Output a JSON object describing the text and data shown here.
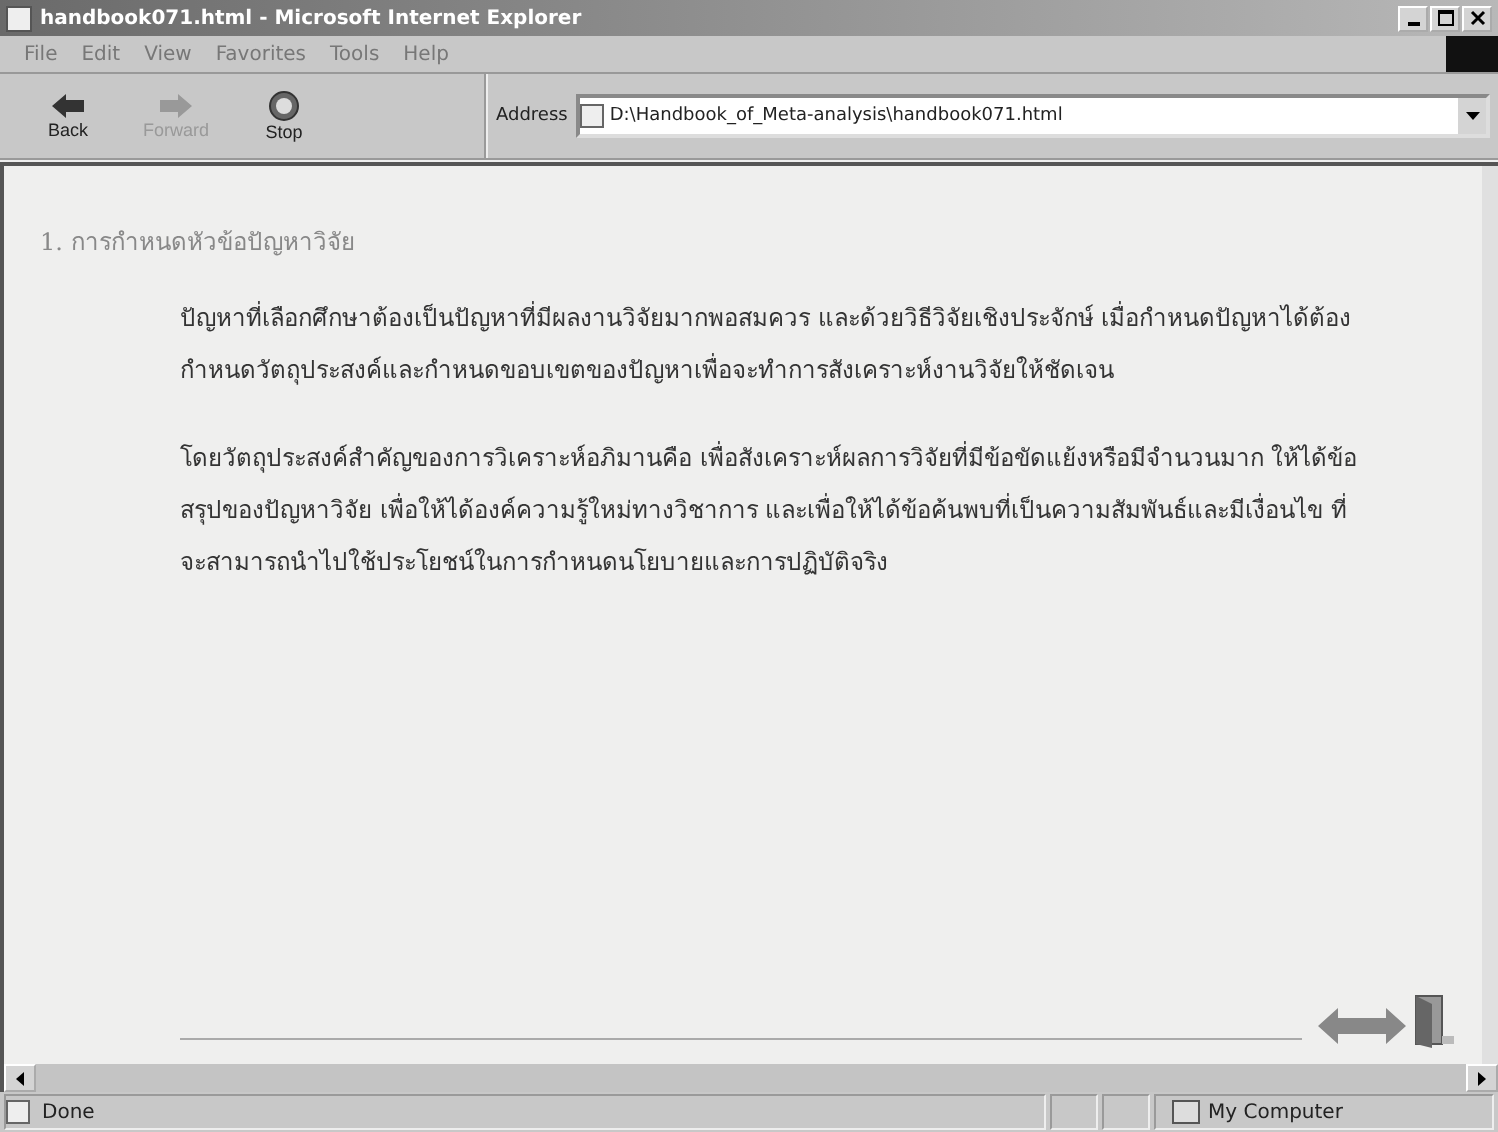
{
  "window": {
    "title": "handbook071.html - Microsoft Internet Explorer"
  },
  "menu": [
    {
      "label": "File"
    },
    {
      "label": "Edit"
    },
    {
      "label": "View"
    },
    {
      "label": "Favorites"
    },
    {
      "label": "Tools"
    },
    {
      "label": "Help"
    }
  ],
  "toolbar": [
    {
      "kind": "back",
      "label": "Back",
      "disabled": false
    },
    {
      "kind": "forward",
      "label": "Forward",
      "disabled": true
    },
    {
      "kind": "stop",
      "label": "Stop",
      "disabled": false
    }
  ],
  "address": {
    "label": "Address",
    "value": "D:\\Handbook_of_Meta-analysis\\handbook071.html"
  },
  "content": {
    "heading": "1. การกำหนดหัวข้อปัญหาวิจัย",
    "paragraphs": [
      "ปัญหาที่เลือกศึกษาต้องเป็นปัญหาที่มีผลงานวิจัยมากพอสมควร และด้วยวิธีวิจัยเชิงประจักษ์ เมื่อกำหนดปัญหาได้ต้องกำหนดวัตถุประสงค์และกำหนดขอบเขตของปัญหาเพื่อจะทำการสังเคราะห์งานวิจัยให้ชัดเจน",
      "โดยวัตถุประสงค์สำคัญของการวิเคราะห์อภิมานคือ เพื่อสังเคราะห์ผลการวิจัยที่มีข้อขัดแย้งหรือมีจำนวนมาก ให้ได้ข้อสรุปของปัญหาวิจัย เพื่อให้ได้องค์ความรู้ใหม่ทางวิชาการ และเพื่อให้ได้ข้อค้นพบที่เป็นความสัมพันธ์และมีเงื่อนไข ที่จะสามารถนำไปใช้ประโยชน์ในการกำหนดนโยบายและการปฏิบัติจริง"
    ]
  },
  "status_bar": {
    "status": "Done",
    "zone": "My Computer"
  }
}
